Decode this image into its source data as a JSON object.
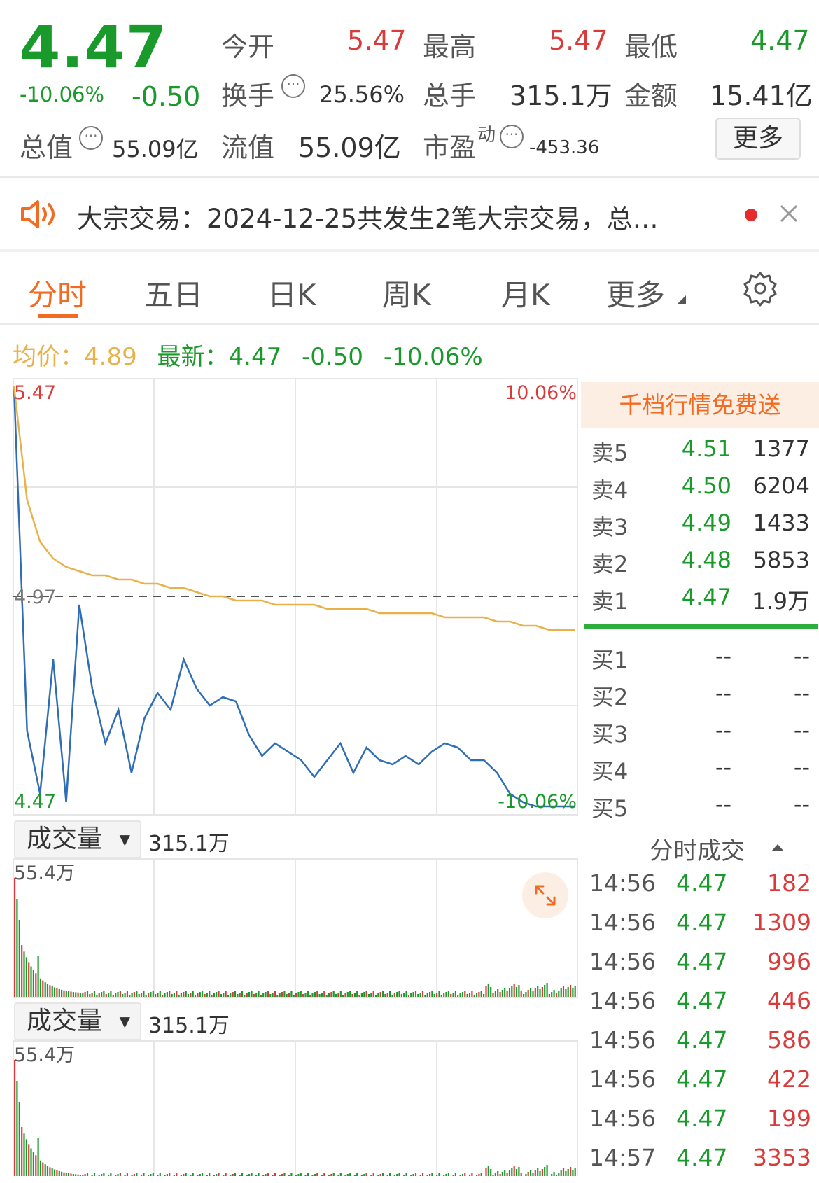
{
  "quote": {
    "price": "4.47",
    "change_pct": "-10.06%",
    "change": "-0.50",
    "stats": {
      "open_label": "今开",
      "open": "5.47",
      "high_label": "最高",
      "high": "5.47",
      "low_label": "最低",
      "low": "4.47",
      "turnover_label": "换手",
      "turnover": "25.56%",
      "volume_label": "总手",
      "volume": "315.1万",
      "amount_label": "金额",
      "amount": "15.41亿",
      "mktcap_label": "总值",
      "mktcap": "55.09亿",
      "float_label": "流值",
      "float": "55.09亿",
      "pe_label": "市盈",
      "pe_sup": "动",
      "pe": "-453.36",
      "more_button": "更多"
    }
  },
  "notice": {
    "text": "大宗交易：2024-12-25共发生2笔大宗交易，总…"
  },
  "tabs": [
    "分时",
    "五日",
    "日K",
    "周K",
    "月K",
    "更多",
    "settings"
  ],
  "summary": {
    "avg_label": "均价：",
    "avg": "4.89",
    "latest_label": "最新：",
    "latest": "4.47",
    "change": "-0.50",
    "change_pct": "-10.06%"
  },
  "chart_data": {
    "type": "line",
    "y_top_label": "5.47",
    "y_mid_label": "4.97",
    "y_bottom_label": "4.47",
    "right_top_label": "10.06%",
    "right_bottom_label": "-10.06%",
    "ylim": [
      4.47,
      5.47
    ],
    "reference_price": 4.97,
    "series": [
      {
        "values": [
          5.47,
          4.65,
          4.5,
          4.82,
          4.48,
          4.95,
          4.75,
          4.62,
          4.7,
          4.55,
          4.68,
          4.74,
          4.7,
          4.82,
          4.75,
          4.71,
          4.73,
          4.72,
          4.64,
          4.59,
          4.62,
          4.6,
          4.58,
          4.54,
          4.58,
          4.62,
          4.55,
          4.61,
          4.58,
          4.57,
          4.59,
          4.57,
          4.6,
          4.62,
          4.61,
          4.58,
          4.58,
          4.55,
          4.5,
          4.48,
          4.47,
          4.47,
          4.47,
          4.47
        ]
      },
      {
        "values": [
          5.47,
          5.2,
          5.1,
          5.06,
          5.04,
          5.03,
          5.02,
          5.02,
          5.01,
          5.01,
          5.0,
          5.0,
          4.99,
          4.99,
          4.98,
          4.97,
          4.97,
          4.96,
          4.96,
          4.96,
          4.95,
          4.95,
          4.95,
          4.95,
          4.94,
          4.94,
          4.94,
          4.94,
          4.93,
          4.93,
          4.93,
          4.93,
          4.93,
          4.92,
          4.92,
          4.92,
          4.92,
          4.91,
          4.91,
          4.9,
          4.9,
          4.89,
          4.89,
          4.89
        ]
      }
    ]
  },
  "volume_panels": [
    {
      "selector": "成交量",
      "total": "315.1万",
      "max_label": "55.4万"
    },
    {
      "selector": "成交量",
      "total": "315.1万",
      "max_label": "55.4万"
    }
  ],
  "orderbook": {
    "banner": "千档行情免费送",
    "asks": [
      {
        "label": "卖5",
        "price": "4.51",
        "vol": "1377"
      },
      {
        "label": "卖4",
        "price": "4.50",
        "vol": "6204"
      },
      {
        "label": "卖3",
        "price": "4.49",
        "vol": "1433"
      },
      {
        "label": "卖2",
        "price": "4.48",
        "vol": "5853"
      },
      {
        "label": "卖1",
        "price": "4.47",
        "vol": "1.9万"
      }
    ],
    "bids": [
      {
        "label": "买1",
        "price": "--",
        "vol": "--"
      },
      {
        "label": "买2",
        "price": "--",
        "vol": "--"
      },
      {
        "label": "买3",
        "price": "--",
        "vol": "--"
      },
      {
        "label": "买4",
        "price": "--",
        "vol": "--"
      },
      {
        "label": "买5",
        "price": "--",
        "vol": "--"
      }
    ]
  },
  "ticks": {
    "title": "分时成交",
    "rows": [
      {
        "time": "14:56",
        "price": "4.47",
        "vol": "182"
      },
      {
        "time": "14:56",
        "price": "4.47",
        "vol": "1309"
      },
      {
        "time": "14:56",
        "price": "4.47",
        "vol": "996"
      },
      {
        "time": "14:56",
        "price": "4.47",
        "vol": "446"
      },
      {
        "time": "14:56",
        "price": "4.47",
        "vol": "586"
      },
      {
        "time": "14:56",
        "price": "4.47",
        "vol": "422"
      },
      {
        "time": "14:56",
        "price": "4.47",
        "vol": "199"
      },
      {
        "time": "14:57",
        "price": "4.47",
        "vol": "3353"
      }
    ]
  },
  "colors": {
    "up": "#d93a3a",
    "down": "#1a9a2a",
    "price_line": "#2f6db5",
    "avg_line": "#e8b24a",
    "accent": "#f26b22"
  },
  "icons": [
    "info-icon",
    "speaker-icon",
    "close-icon",
    "settings-gear-icon",
    "expand-icon",
    "dropdown-triangle-icon",
    "sort-up-icon"
  ]
}
